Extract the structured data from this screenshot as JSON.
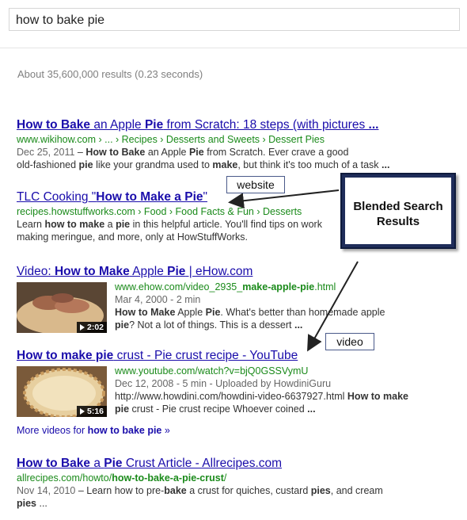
{
  "search": {
    "query": "how to bake pie"
  },
  "stats": "About 35,600,000 results (0.23 seconds)",
  "results": [
    {
      "title_parts": [
        [
          "How to Bake",
          1
        ],
        [
          " an Apple ",
          0
        ],
        [
          "Pie",
          1
        ],
        [
          " from Scratch: 18 steps (with pictures ",
          0
        ],
        [
          "...",
          1
        ]
      ],
      "url": "www.wikihow.com › ... › Recipes › Desserts and Sweets › Dessert Pies",
      "snippet_lines": [
        [
          [
            "Dec 25, 2011",
            2
          ],
          [
            " – ",
            0
          ],
          [
            "How to Bake",
            1
          ],
          [
            " an Apple ",
            0
          ],
          [
            "Pie",
            1
          ],
          [
            " from Scratch. Ever crave a good",
            0
          ]
        ],
        [
          [
            "old-fashioned ",
            0
          ],
          [
            "pie",
            1
          ],
          [
            " like your grandma used to ",
            0
          ],
          [
            "make",
            1
          ],
          [
            ", but think it's too much of a task ",
            0
          ],
          [
            "...",
            1
          ]
        ]
      ]
    },
    {
      "title_parts": [
        [
          "TLC Cooking \"",
          0
        ],
        [
          "How to Make a Pie",
          1
        ],
        [
          "\"",
          0
        ]
      ],
      "url": "recipes.howstuffworks.com › Food › Food Facts & Fun › Desserts",
      "snippet_lines": [
        [
          [
            "Learn ",
            0
          ],
          [
            "how to make",
            1
          ],
          [
            " a ",
            0
          ],
          [
            "pie",
            1
          ],
          [
            " in this helpful article. You'll find tips on work",
            0
          ]
        ],
        [
          [
            "making meringue, and more, only at HowStuffWorks.",
            0
          ]
        ]
      ]
    },
    {
      "title_parts": [
        [
          "Video: ",
          0
        ],
        [
          "How to Make",
          1
        ],
        [
          " Apple ",
          0
        ],
        [
          "Pie",
          1
        ],
        [
          " | eHow.com",
          0
        ]
      ],
      "url_parts": [
        [
          "www.ehow.com/video_2935_",
          0
        ],
        [
          "make-apple-pie",
          1
        ],
        [
          ".html",
          0
        ]
      ],
      "meta": "Mar 4, 2000 - 2 min",
      "snippet_lines": [
        [
          [
            "How to Make",
            1
          ],
          [
            " Apple ",
            0
          ],
          [
            "Pie",
            1
          ],
          [
            ". What's better than homemade apple",
            0
          ]
        ],
        [
          [
            "pie",
            1
          ],
          [
            "? Not a lot of things. This is a dessert ",
            0
          ],
          [
            "...",
            1
          ]
        ]
      ],
      "duration": "2:02"
    },
    {
      "title_parts": [
        [
          "How to make pie",
          1
        ],
        [
          " crust - Pie crust recipe - YouTube",
          0
        ]
      ],
      "url": "www.youtube.com/watch?v=bjQ0GSSVymU",
      "meta": "Dec 12, 2008 - 5 min - Uploaded by HowdiniGuru",
      "snippet_lines": [
        [
          [
            "http://www.howdini.com/howdini-video-6637927.html ",
            0
          ],
          [
            "How to make",
            1
          ]
        ],
        [
          [
            "pie",
            1
          ],
          [
            " crust - Pie crust recipe Whoever coined ",
            0
          ],
          [
            "...",
            1
          ]
        ]
      ],
      "duration": "5:16"
    },
    {
      "title_parts": [
        [
          "How to Bake",
          1
        ],
        [
          " a ",
          0
        ],
        [
          "Pie",
          1
        ],
        [
          " Crust Article - Allrecipes.com",
          0
        ]
      ],
      "url_parts": [
        [
          "allrecipes.com/howto/",
          0
        ],
        [
          "how-to-bake-a-pie-crust",
          1
        ],
        [
          "/",
          0
        ]
      ],
      "snippet_lines": [
        [
          [
            "Nov 14, 2010",
            2
          ],
          [
            " – Learn how to pre-",
            0
          ],
          [
            "bake",
            1
          ],
          [
            " a crust for quiches, custard ",
            0
          ],
          [
            "pies",
            1
          ],
          [
            ", and cream",
            0
          ]
        ],
        [
          [
            "pies",
            1
          ],
          [
            " ...",
            0
          ]
        ]
      ]
    }
  ],
  "more_videos": {
    "prefix": "More videos for ",
    "query": "how to bake pie",
    "suffix": " »"
  },
  "annotations": {
    "callout": "Blended Search Results",
    "website_label": "website",
    "video_label": "video"
  }
}
